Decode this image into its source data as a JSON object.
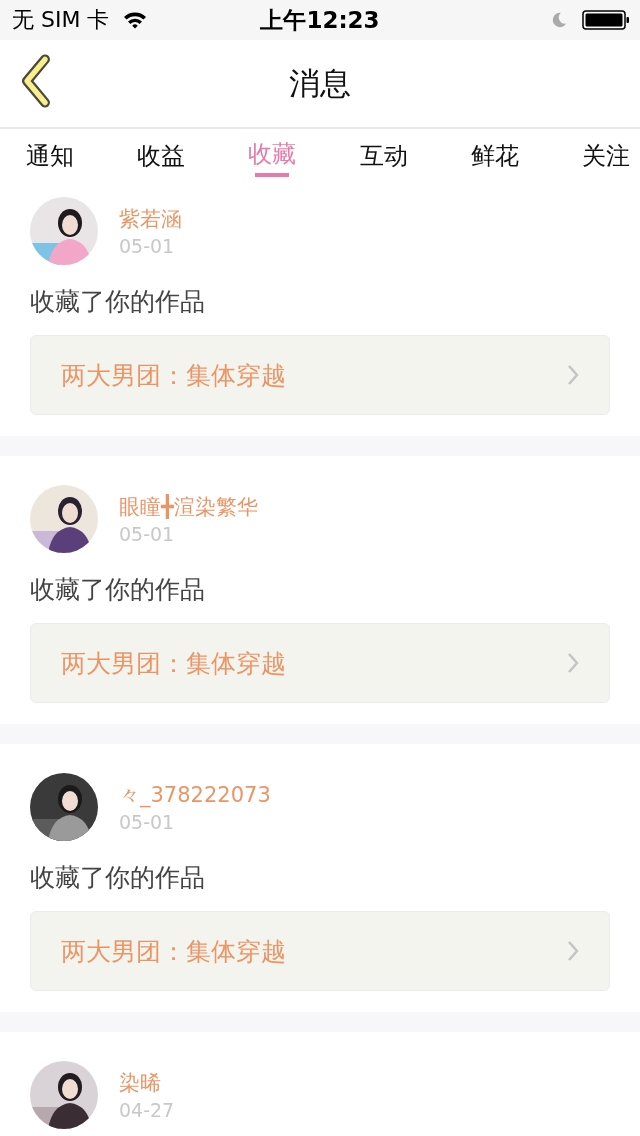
{
  "status_bar": {
    "carrier": "无 SIM 卡",
    "time": "上午12:23"
  },
  "header": {
    "title": "消息"
  },
  "tabs": [
    {
      "label": "通知",
      "selected": false
    },
    {
      "label": "收益",
      "selected": false
    },
    {
      "label": "收藏",
      "selected": true
    },
    {
      "label": "互动",
      "selected": false
    },
    {
      "label": "鲜花",
      "selected": false
    },
    {
      "label": "关注",
      "selected": false
    }
  ],
  "messages": [
    {
      "name": "紫若涵",
      "date": "05-01",
      "action": "收藏了你的作品",
      "work": "两大男团：集体穿越"
    },
    {
      "name": "眼瞳╋渲染繁华",
      "date": "05-01",
      "action": "收藏了你的作品",
      "work": "两大男团：集体穿越"
    },
    {
      "name": "々_378222073",
      "date": "05-01",
      "action": "收藏了你的作品",
      "work": "两大男团：集体穿越"
    },
    {
      "name": "染晞",
      "date": "04-27"
    }
  ]
}
